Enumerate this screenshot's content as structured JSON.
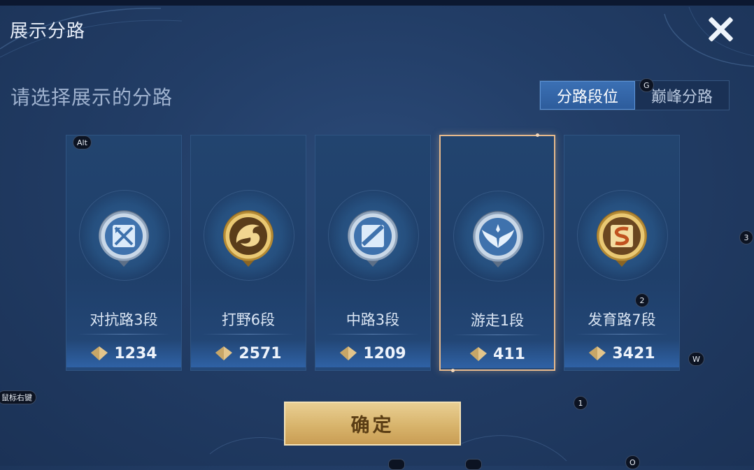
{
  "header": {
    "title": "展示分路",
    "close_icon": "close-icon"
  },
  "prompt": "请选择展示的分路",
  "tabs": [
    {
      "label": "分路段位",
      "active": true
    },
    {
      "label": "巅峰分路",
      "active": false
    }
  ],
  "hotkeys": {
    "alt": "Alt",
    "g": "G",
    "three": "3",
    "two": "2",
    "w": "W",
    "one": "1",
    "right_click": "鼠标右键",
    "o": "O"
  },
  "cards": [
    {
      "rank": "对抗路3段",
      "score": "1234",
      "icon": "clash-lane-icon",
      "tier": "silver",
      "selected": false
    },
    {
      "rank": "打野6段",
      "score": "2571",
      "icon": "jungle-dragon-icon",
      "tier": "gold",
      "selected": false
    },
    {
      "rank": "中路3段",
      "score": "1209",
      "icon": "mid-lane-icon",
      "tier": "silver",
      "selected": false
    },
    {
      "rank": "游走1段",
      "score": "411",
      "icon": "roam-wings-icon",
      "tier": "silver",
      "selected": true
    },
    {
      "rank": "发育路7段",
      "score": "3421",
      "icon": "farm-lane-icon",
      "tier": "gold",
      "selected": false
    }
  ],
  "confirm_label": "确定",
  "colors": {
    "selected_border": "#e6b98c",
    "gold_button": "#d8b46c",
    "active_tab": "#3b70b4"
  }
}
